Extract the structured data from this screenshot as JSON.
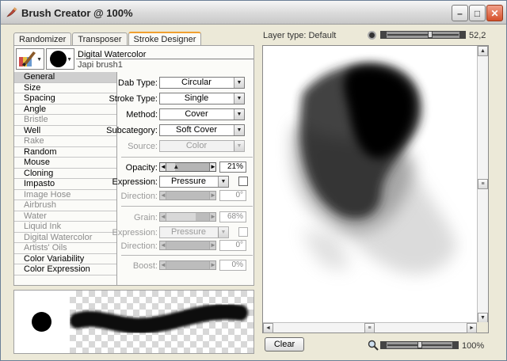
{
  "window": {
    "title": "Brush Creator @ 100%",
    "min_glyph": "–",
    "max_glyph": "□",
    "close_glyph": "✕"
  },
  "tabs": [
    {
      "label": "Randomizer",
      "active": false
    },
    {
      "label": "Transposer",
      "active": false
    },
    {
      "label": "Stroke Designer",
      "active": true
    }
  ],
  "brush": {
    "category": "Digital Watercolor",
    "variant": "Japi brush1"
  },
  "categories": [
    {
      "label": "General",
      "active": true,
      "disabled": false
    },
    {
      "label": "Size",
      "active": false,
      "disabled": false
    },
    {
      "label": "Spacing",
      "active": false,
      "disabled": false
    },
    {
      "label": "Angle",
      "active": false,
      "disabled": false
    },
    {
      "label": "Bristle",
      "active": false,
      "disabled": true
    },
    {
      "label": "Well",
      "active": false,
      "disabled": false
    },
    {
      "label": "Rake",
      "active": false,
      "disabled": true
    },
    {
      "label": "Random",
      "active": false,
      "disabled": false
    },
    {
      "label": "Mouse",
      "active": false,
      "disabled": false
    },
    {
      "label": "Cloning",
      "active": false,
      "disabled": false
    },
    {
      "label": "Impasto",
      "active": false,
      "disabled": false
    },
    {
      "label": "Image Hose",
      "active": false,
      "disabled": true
    },
    {
      "label": "Airbrush",
      "active": false,
      "disabled": true
    },
    {
      "label": "Water",
      "active": false,
      "disabled": true
    },
    {
      "label": "Liquid Ink",
      "active": false,
      "disabled": true
    },
    {
      "label": "Digital Watercolor",
      "active": false,
      "disabled": true
    },
    {
      "label": "Artists' Oils",
      "active": false,
      "disabled": true
    },
    {
      "label": "Color Variability",
      "active": false,
      "disabled": false
    },
    {
      "label": "Color Expression",
      "active": false,
      "disabled": false
    }
  ],
  "general": {
    "dab_type": {
      "label": "Dab Type:",
      "value": "Circular"
    },
    "stroke_type": {
      "label": "Stroke Type:",
      "value": "Single"
    },
    "method": {
      "label": "Method:",
      "value": "Cover"
    },
    "subcategory": {
      "label": "Subcategory:",
      "value": "Soft Cover"
    },
    "source": {
      "label": "Source:",
      "value": "Color"
    },
    "opacity": {
      "label": "Opacity:",
      "value": "21%",
      "fraction": 0.21
    },
    "opacity_expression": {
      "label": "Expression:",
      "value": "Pressure"
    },
    "opacity_direction": {
      "label": "Direction:",
      "value": "0°",
      "fraction": 0.0
    },
    "grain": {
      "label": "Grain:",
      "value": "68%",
      "fraction": 0.68
    },
    "grain_expression": {
      "label": "Expression:",
      "value": "Pressure"
    },
    "grain_direction": {
      "label": "Direction:",
      "value": "0°",
      "fraction": 0.0
    },
    "boost": {
      "label": "Boost:",
      "value": "0%",
      "fraction": 0.0
    }
  },
  "glyphs": {
    "dropdown": "▼",
    "slider_left": "◄",
    "slider_right": "►",
    "slider_thumb": "▲",
    "scroll_up": "▲",
    "scroll_down": "▼",
    "scroll_left": "◄",
    "scroll_right": "►",
    "scroll_grip": "≡"
  },
  "preview_panel": {
    "layer_type": "Layer type: Default",
    "brush_size_value": "52,2",
    "brush_size_fraction": 0.6,
    "clear_label": "Clear",
    "zoom_value": "100%",
    "zoom_fraction": 0.5
  },
  "icons": {
    "app": "brush-creator-app-icon",
    "category": "watercolor-brush-category-icon",
    "variant": "round-dab-variant-icon",
    "zoom": "magnifier-icon"
  },
  "colors": {
    "active_tab_accent": "#f0a030",
    "close_button": "#d5502a"
  }
}
